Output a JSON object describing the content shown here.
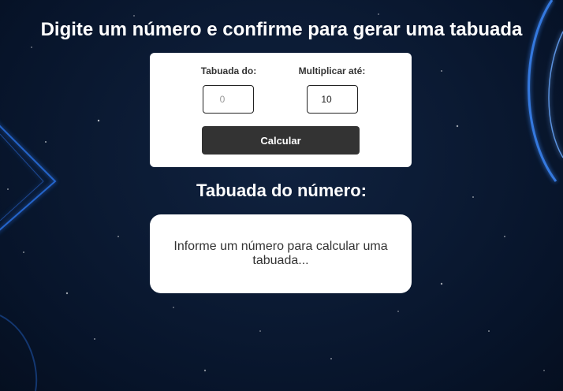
{
  "header": {
    "title": "Digite um número e confirme para gerar uma tabuada"
  },
  "form": {
    "base_label": "Tabuada do:",
    "base_placeholder": "0",
    "base_value": "",
    "limit_label": "Multiplicar até:",
    "limit_value": "10",
    "submit_label": "Calcular"
  },
  "result": {
    "title": "Tabuada do número:",
    "message": "Informe um número para calcular uma tabuada..."
  },
  "colors": {
    "background": "#0b1a33",
    "card": "#ffffff",
    "button": "#333333",
    "glow": "#2f7fff"
  }
}
